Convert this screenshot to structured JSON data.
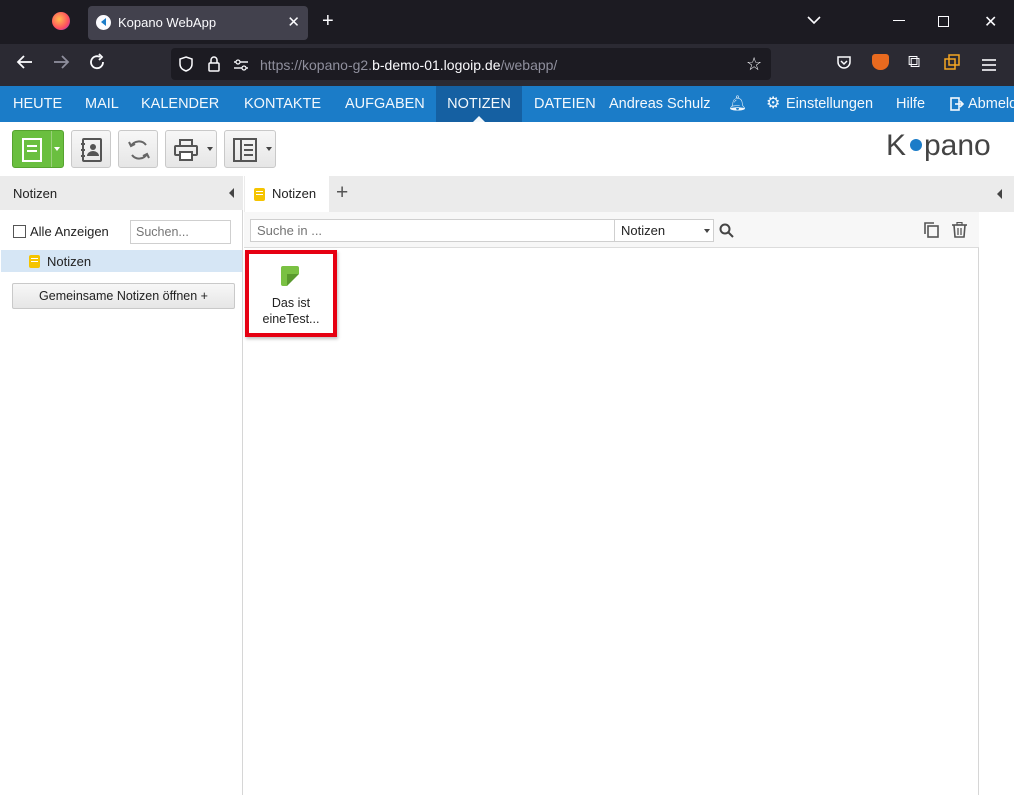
{
  "browser": {
    "tab_title": "Kopano WebApp",
    "url_prefix": "https://kopano-g2.",
    "url_domain": "b-demo-01.logoip.de",
    "url_path": "/webapp/"
  },
  "menu": {
    "items": [
      "HEUTE",
      "MAIL",
      "KALENDER",
      "KONTAKTE",
      "AUFGABEN",
      "NOTIZEN",
      "DATEIEN"
    ],
    "active": "NOTIZEN",
    "user": "Andreas Schulz",
    "settings": "Einstellungen",
    "help": "Hilfe",
    "logout": "Abmeld"
  },
  "logo_text": "Kopano",
  "left_panel": {
    "title": "Notizen",
    "show_all_label": "Alle Anzeigen",
    "search_placeholder": "Suchen...",
    "folder": "Notizen",
    "open_shared_button": "Gemeinsame Notizen öffnen +"
  },
  "content": {
    "tab_label": "Notizen",
    "search_placeholder": "Suche in ...",
    "search_scope": "Notizen",
    "note_line1": "Das ist",
    "note_line2": "eineTest..."
  },
  "colors": {
    "menu_bg": "#1b7cc8",
    "menu_active": "#155fa0",
    "note_green": "#7ac143",
    "folder_yellow": "#f5c400",
    "highlight_red": "#e60012"
  }
}
